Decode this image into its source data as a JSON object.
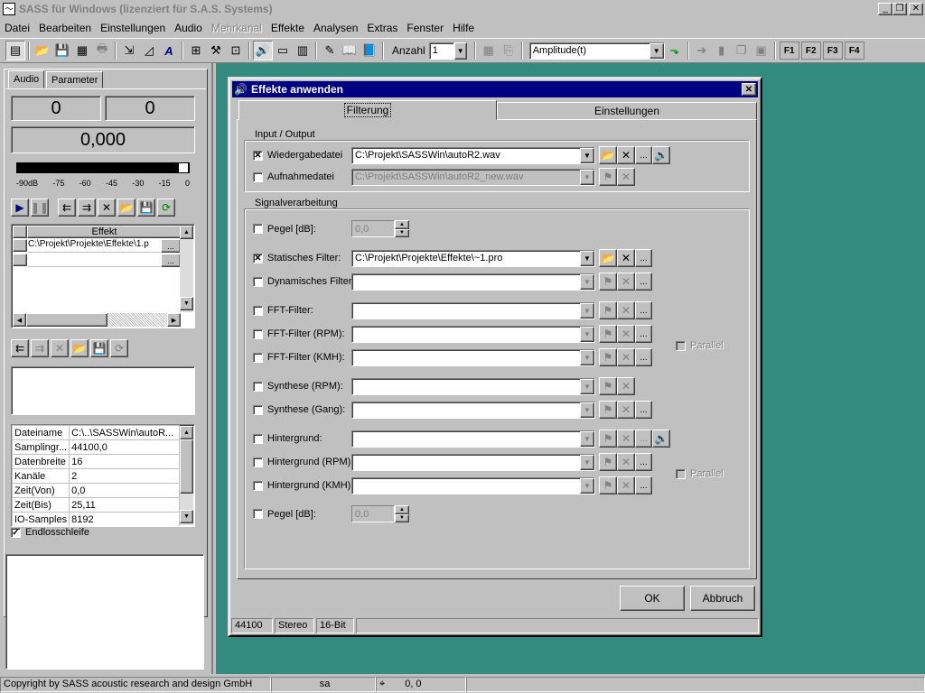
{
  "app": {
    "title": "SASS für Windows (lizenziert für S.A.S. Systems)"
  },
  "menu": [
    "Datei",
    "Bearbeiten",
    "Einstellungen",
    "Audio",
    "Mehrkanal",
    "Effekte",
    "Analysen",
    "Extras",
    "Fenster",
    "Hilfe"
  ],
  "toolbar": {
    "anzahl_label": "Anzahl",
    "anzahl_value": "1",
    "view_value": "Amplitude(t)",
    "fkeys": [
      "F1",
      "F2",
      "F3",
      "F4"
    ]
  },
  "left": {
    "tabs": [
      "Audio",
      "Parameter"
    ],
    "counter_a": "0",
    "counter_b": "0",
    "time": "0,000",
    "meter_labels": [
      "-90dB",
      "-75",
      "-60",
      "-45",
      "-30",
      "-15",
      "0"
    ],
    "effects_header": "Effekt",
    "effects": [
      "C:\\Projekt\\Projekte\\Effekte\\1.p",
      ""
    ],
    "props": [
      [
        "Dateiname",
        "C:\\..\\SASSWin\\autoR..."
      ],
      [
        "Samplingr...",
        "44100,0"
      ],
      [
        "Datenbreite",
        "16"
      ],
      [
        "Kanäle",
        "2"
      ],
      [
        "Zeit(Von)",
        "0,0"
      ],
      [
        "Zeit(Bis)",
        "25,11"
      ],
      [
        "IO-Samples",
        "8192"
      ]
    ],
    "loop_label": "Endlosschleife"
  },
  "dialog": {
    "title": "Effekte anwenden",
    "tabs": [
      "Filterung",
      "Einstellungen"
    ],
    "io_group": "Input / Output",
    "playback_label": "Wiedergabedatei",
    "playback_value": "C:\\Projekt\\SASSWin\\autoR2.wav",
    "record_label": "Aufnahmedatei",
    "record_value": "C:\\Projekt\\SASSWin\\autoR2_new.wav",
    "signal_group": "Signalverarbeitung",
    "level1_label": "Pegel [dB]:",
    "level1_value": "0,0",
    "static_label": "Statisches Filter:",
    "static_value": "C:\\Projekt\\Projekte\\Effekte\\~1.pro",
    "dynamic_label": "Dynamisches Filter:",
    "fft_label": "FFT-Filter:",
    "fft_rpm_label": "FFT-Filter (RPM):",
    "fft_kmh_label": "FFT-Filter (KMH):",
    "parallel1_label": "Parallel",
    "synth_rpm_label": "Synthese (RPM):",
    "synth_gang_label": "Synthese (Gang):",
    "bg_label": "Hintergrund:",
    "bg_rpm_label": "Hintergrund (RPM):",
    "bg_kmh_label": "Hintergrund (KMH):",
    "parallel2_label": "Parallel",
    "level2_label": "Pegel [dB]:",
    "level2_value": "0,0",
    "ok": "OK",
    "cancel": "Abbruch",
    "status": [
      "44100",
      "Stereo",
      "16-Bit"
    ]
  },
  "status": {
    "copyright": "Copyright by SASS acoustic research and design GmbH",
    "unit": "sa",
    "coords": "0, 0"
  },
  "colors": {
    "workspace": "#338a7f",
    "titlebar": "#000080"
  }
}
